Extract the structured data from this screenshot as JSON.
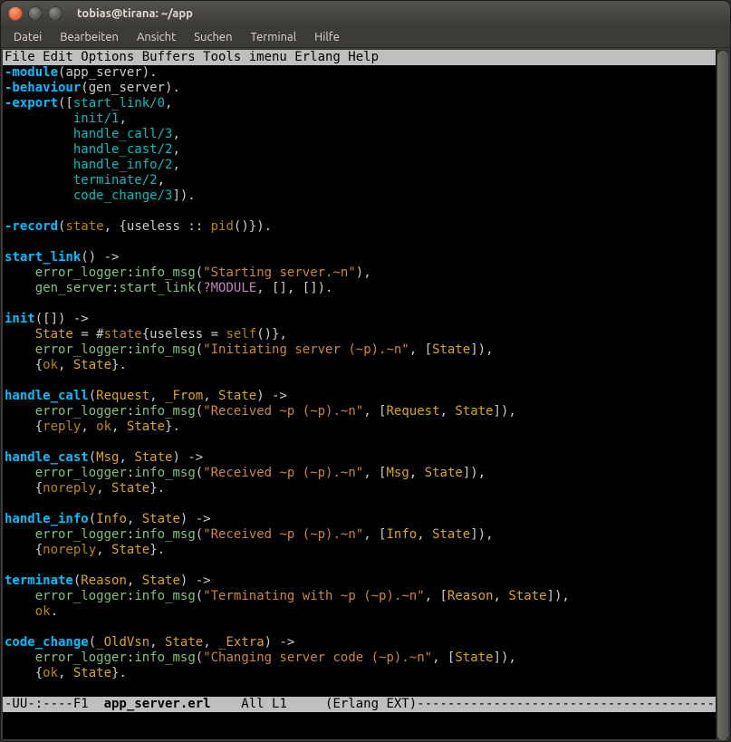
{
  "window": {
    "title": "tobias@tirana: ~/app"
  },
  "menubar": {
    "items": [
      "Datei",
      "Bearbeiten",
      "Ansicht",
      "Suchen",
      "Terminal",
      "Hilfe"
    ]
  },
  "emacs_menu": "File Edit Options Buffers Tools imenu Erlang Help                               ",
  "code_lines": [
    [
      [
        "kw",
        "-module"
      ],
      [
        "plain",
        "("
      ],
      [
        "plain",
        "app_server"
      ],
      [
        "plain",
        ")."
      ]
    ],
    [
      [
        "kw",
        "-behaviour"
      ],
      [
        "plain",
        "("
      ],
      [
        "plain",
        "gen_server"
      ],
      [
        "plain",
        ")."
      ]
    ],
    [
      [
        "kw",
        "-export"
      ],
      [
        "plain",
        "(["
      ],
      [
        "atom",
        "start_link/0"
      ],
      [
        "plain",
        ","
      ]
    ],
    [
      [
        "plain",
        "         "
      ],
      [
        "atom",
        "init/1"
      ],
      [
        "plain",
        ","
      ]
    ],
    [
      [
        "plain",
        "         "
      ],
      [
        "atom",
        "handle_call/3"
      ],
      [
        "plain",
        ","
      ]
    ],
    [
      [
        "plain",
        "         "
      ],
      [
        "atom",
        "handle_cast/2"
      ],
      [
        "plain",
        ","
      ]
    ],
    [
      [
        "plain",
        "         "
      ],
      [
        "atom",
        "handle_info/2"
      ],
      [
        "plain",
        ","
      ]
    ],
    [
      [
        "plain",
        "         "
      ],
      [
        "atom",
        "terminate/2"
      ],
      [
        "plain",
        ","
      ]
    ],
    [
      [
        "plain",
        "         "
      ],
      [
        "atom",
        "code_change/3"
      ],
      [
        "plain",
        "])."
      ]
    ],
    [],
    [
      [
        "kw",
        "-record"
      ],
      [
        "plain",
        "("
      ],
      [
        "type",
        "state"
      ],
      [
        "plain",
        ", {useless :: "
      ],
      [
        "type",
        "pid"
      ],
      [
        "plain",
        "()})."
      ]
    ],
    [],
    [
      [
        "func",
        "start_link"
      ],
      [
        "plain",
        "() ->"
      ]
    ],
    [
      [
        "plain",
        "    "
      ],
      [
        "call",
        "error_logger"
      ],
      [
        "plain",
        ":"
      ],
      [
        "call",
        "info_msg"
      ],
      [
        "plain",
        "("
      ],
      [
        "str",
        "\"Starting server.~n\""
      ],
      [
        "plain",
        "),"
      ]
    ],
    [
      [
        "plain",
        "    "
      ],
      [
        "call",
        "gen_server"
      ],
      [
        "plain",
        ":"
      ],
      [
        "call",
        "start_link"
      ],
      [
        "plain",
        "("
      ],
      [
        "mac",
        "?MODULE"
      ],
      [
        "plain",
        ", [], [])."
      ]
    ],
    [],
    [
      [
        "func",
        "init"
      ],
      [
        "plain",
        "([]) ->"
      ]
    ],
    [
      [
        "plain",
        "    "
      ],
      [
        "var",
        "State"
      ],
      [
        "plain",
        " = #"
      ],
      [
        "type",
        "state"
      ],
      [
        "plain",
        "{useless = "
      ],
      [
        "type",
        "self"
      ],
      [
        "plain",
        "()},"
      ]
    ],
    [
      [
        "plain",
        "    "
      ],
      [
        "call",
        "error_logger"
      ],
      [
        "plain",
        ":"
      ],
      [
        "call",
        "info_msg"
      ],
      [
        "plain",
        "("
      ],
      [
        "str",
        "\"Initiating server (~p).~n\""
      ],
      [
        "plain",
        ", ["
      ],
      [
        "var",
        "State"
      ],
      [
        "plain",
        "]),"
      ]
    ],
    [
      [
        "plain",
        "    {"
      ],
      [
        "type",
        "ok"
      ],
      [
        "plain",
        ", "
      ],
      [
        "var",
        "State"
      ],
      [
        "plain",
        "}."
      ]
    ],
    [],
    [
      [
        "func",
        "handle_call"
      ],
      [
        "plain",
        "("
      ],
      [
        "var",
        "Request"
      ],
      [
        "plain",
        ", "
      ],
      [
        "var",
        "_From"
      ],
      [
        "plain",
        ", "
      ],
      [
        "var",
        "State"
      ],
      [
        "plain",
        ") ->"
      ]
    ],
    [
      [
        "plain",
        "    "
      ],
      [
        "call",
        "error_logger"
      ],
      [
        "plain",
        ":"
      ],
      [
        "call",
        "info_msg"
      ],
      [
        "plain",
        "("
      ],
      [
        "str",
        "\"Received ~p (~p).~n\""
      ],
      [
        "plain",
        ", ["
      ],
      [
        "var",
        "Request"
      ],
      [
        "plain",
        ", "
      ],
      [
        "var",
        "State"
      ],
      [
        "plain",
        "]),"
      ]
    ],
    [
      [
        "plain",
        "    {"
      ],
      [
        "type",
        "reply"
      ],
      [
        "plain",
        ", "
      ],
      [
        "type",
        "ok"
      ],
      [
        "plain",
        ", "
      ],
      [
        "var",
        "State"
      ],
      [
        "plain",
        "}."
      ]
    ],
    [],
    [
      [
        "func",
        "handle_cast"
      ],
      [
        "plain",
        "("
      ],
      [
        "var",
        "Msg"
      ],
      [
        "plain",
        ", "
      ],
      [
        "var",
        "State"
      ],
      [
        "plain",
        ") ->"
      ]
    ],
    [
      [
        "plain",
        "    "
      ],
      [
        "call",
        "error_logger"
      ],
      [
        "plain",
        ":"
      ],
      [
        "call",
        "info_msg"
      ],
      [
        "plain",
        "("
      ],
      [
        "str",
        "\"Received ~p (~p).~n\""
      ],
      [
        "plain",
        ", ["
      ],
      [
        "var",
        "Msg"
      ],
      [
        "plain",
        ", "
      ],
      [
        "var",
        "State"
      ],
      [
        "plain",
        "]),"
      ]
    ],
    [
      [
        "plain",
        "    {"
      ],
      [
        "type",
        "noreply"
      ],
      [
        "plain",
        ", "
      ],
      [
        "var",
        "State"
      ],
      [
        "plain",
        "}."
      ]
    ],
    [],
    [
      [
        "func",
        "handle_info"
      ],
      [
        "plain",
        "("
      ],
      [
        "var",
        "Info"
      ],
      [
        "plain",
        ", "
      ],
      [
        "var",
        "State"
      ],
      [
        "plain",
        ") ->"
      ]
    ],
    [
      [
        "plain",
        "    "
      ],
      [
        "call",
        "error_logger"
      ],
      [
        "plain",
        ":"
      ],
      [
        "call",
        "info_msg"
      ],
      [
        "plain",
        "("
      ],
      [
        "str",
        "\"Received ~p (~p).~n\""
      ],
      [
        "plain",
        ", ["
      ],
      [
        "var",
        "Info"
      ],
      [
        "plain",
        ", "
      ],
      [
        "var",
        "State"
      ],
      [
        "plain",
        "]),"
      ]
    ],
    [
      [
        "plain",
        "    {"
      ],
      [
        "type",
        "noreply"
      ],
      [
        "plain",
        ", "
      ],
      [
        "var",
        "State"
      ],
      [
        "plain",
        "}."
      ]
    ],
    [],
    [
      [
        "func",
        "terminate"
      ],
      [
        "plain",
        "("
      ],
      [
        "var",
        "Reason"
      ],
      [
        "plain",
        ", "
      ],
      [
        "var",
        "State"
      ],
      [
        "plain",
        ") ->"
      ]
    ],
    [
      [
        "plain",
        "    "
      ],
      [
        "call",
        "error_logger"
      ],
      [
        "plain",
        ":"
      ],
      [
        "call",
        "info_msg"
      ],
      [
        "plain",
        "("
      ],
      [
        "str",
        "\"Terminating with ~p (~p).~n\""
      ],
      [
        "plain",
        ", ["
      ],
      [
        "var",
        "Reason"
      ],
      [
        "plain",
        ", "
      ],
      [
        "var",
        "State"
      ],
      [
        "plain",
        "]),"
      ]
    ],
    [
      [
        "plain",
        "    "
      ],
      [
        "type",
        "ok"
      ],
      [
        "plain",
        "."
      ]
    ],
    [],
    [
      [
        "func",
        "code_change"
      ],
      [
        "plain",
        "("
      ],
      [
        "var",
        "_OldVsn"
      ],
      [
        "plain",
        ", "
      ],
      [
        "var",
        "State"
      ],
      [
        "plain",
        ", "
      ],
      [
        "var",
        "_Extra"
      ],
      [
        "plain",
        ") ->"
      ]
    ],
    [
      [
        "plain",
        "    "
      ],
      [
        "call",
        "error_logger"
      ],
      [
        "plain",
        ":"
      ],
      [
        "call",
        "info_msg"
      ],
      [
        "plain",
        "("
      ],
      [
        "str",
        "\"Changing server code (~p).~n\""
      ],
      [
        "plain",
        ", ["
      ],
      [
        "var",
        "State"
      ],
      [
        "plain",
        "]),"
      ]
    ],
    [
      [
        "plain",
        "    {"
      ],
      [
        "type",
        "ok"
      ],
      [
        "plain",
        ", "
      ],
      [
        "var",
        "State"
      ],
      [
        "plain",
        "}."
      ]
    ],
    []
  ],
  "modeline": {
    "prefix": "-UU-:----F1  ",
    "buffer": "app_server.erl",
    "mid": "    All L1     (Erlang EXT)",
    "dashes": "----------------------------------------"
  }
}
